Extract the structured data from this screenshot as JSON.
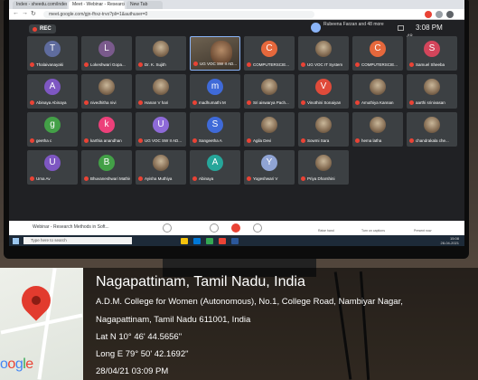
{
  "browser": {
    "tabs": [
      "Index - sheedu.com/index",
      "Meet - Webinar - Research M",
      "New Tab"
    ],
    "url": "meet.google.com/gjn-fhxz-trvo?pli=1&authuser=0"
  },
  "meet": {
    "rec_label": "REC",
    "presenter": "Rubeena Farzan and 48 more",
    "participant_count": "48",
    "clock": "3:08 PM",
    "tiles": [
      {
        "name": "Thalaivanayaki",
        "initial": "T",
        "color": "#5f6c9e"
      },
      {
        "name": "Lokeshwari Gopa...",
        "initial": "L",
        "color": "#7a5a8c"
      },
      {
        "name": "Dr. K. Sujith",
        "initial": "",
        "color": ""
      },
      {
        "name": "UG VOC SW II AD...",
        "initial": "",
        "color": ""
      },
      {
        "name": "COMPUTERSCIE...",
        "initial": "C",
        "color": "#e6683c"
      },
      {
        "name": "UG VOC IT System",
        "initial": "",
        "color": ""
      },
      {
        "name": "COMPUTERSCIE...",
        "initial": "C",
        "color": "#e6683c"
      },
      {
        "name": "Samuel Sheeba",
        "initial": "S",
        "color": "#d3455b"
      },
      {
        "name": "Abinaya Abinaya",
        "initial": "A",
        "color": "#7e57c2"
      },
      {
        "name": "nivedhitha nivi",
        "initial": "",
        "color": ""
      },
      {
        "name": "Hanan V hari",
        "initial": "",
        "color": ""
      },
      {
        "name": "madhumathi M",
        "initial": "m",
        "color": "#3f6ad8"
      },
      {
        "name": "Sri aiswarya Pach...",
        "initial": "",
        "color": ""
      },
      {
        "name": "Vinothini Sonaiyan",
        "initial": "V",
        "color": "#e04b3a"
      },
      {
        "name": "Amuthiya Kannan",
        "initial": "",
        "color": ""
      },
      {
        "name": "aarthi srinivasan",
        "initial": "",
        "color": ""
      },
      {
        "name": "geetha c",
        "initial": "g",
        "color": "#43a047"
      },
      {
        "name": "karthia anandhan",
        "initial": "k",
        "color": "#ec407a"
      },
      {
        "name": "UG VOC SW II AD...",
        "initial": "U",
        "color": "#8e6ad8"
      },
      {
        "name": "Sangeetha A",
        "initial": "S",
        "color": "#3f6ad8"
      },
      {
        "name": "Agila Devi",
        "initial": "",
        "color": ""
      },
      {
        "name": "Sowmi Sara",
        "initial": "",
        "color": ""
      },
      {
        "name": "hema latha",
        "initial": "",
        "color": ""
      },
      {
        "name": "chandrakala che...",
        "initial": "",
        "color": ""
      },
      {
        "name": "Uma Av",
        "initial": "U",
        "color": "#7e57c2"
      },
      {
        "name": "Bhuvaneshwari Mathivanan",
        "initial": "B",
        "color": "#43a047"
      },
      {
        "name": "Ayisha Muthiya",
        "initial": "",
        "color": ""
      },
      {
        "name": "Abinaya",
        "initial": "A",
        "color": "#26a69a"
      },
      {
        "name": "Yogeshwari V",
        "initial": "Y",
        "color": "#90a4d4"
      },
      {
        "name": "Priya Dharshini",
        "initial": "",
        "color": ""
      }
    ],
    "toolbar_title": "Webinar - Research Methods in Soft...",
    "toolbar_labels": [
      "Raise hand",
      "Turn on captions",
      "Present now"
    ]
  },
  "taskbar": {
    "search_placeholder": "Type here to search",
    "tray_time": "15:08",
    "tray_date": "28-04-2021"
  },
  "geotag": {
    "location": "Nagapattinam, Tamil Nadu, India",
    "address_line1": "A.D.M. College for Women (Autonomous), No.1, College Road, Nambiyar Nagar,",
    "address_line2": "Nagapattinam, Tamil Nadu 611001, India",
    "lat": "Lat N 10° 46' 44.5656\"",
    "long": "Long E 79° 50' 42.1692\"",
    "timestamp": "28/04/21 03:09 PM",
    "logo_text": "oogle"
  }
}
